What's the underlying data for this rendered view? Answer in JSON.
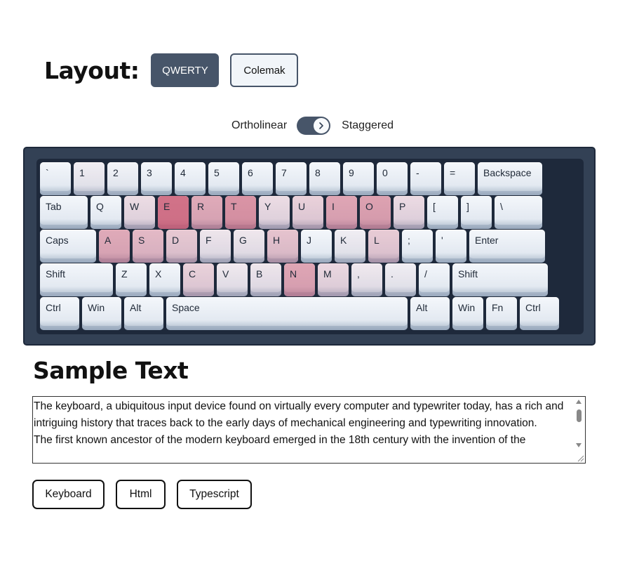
{
  "layout": {
    "title": "Layout:",
    "options": [
      {
        "label": "QWERTY",
        "active": true
      },
      {
        "label": "Colemak",
        "active": false
      }
    ]
  },
  "toggle": {
    "left_label": "Ortholinear",
    "right_label": "Staggered",
    "state": "Staggered"
  },
  "keyboard": {
    "heat_color": "#c84d68",
    "rows": [
      [
        {
          "label": "`",
          "heat": 0
        },
        {
          "label": "1",
          "heat": 0.05
        },
        {
          "label": "2",
          "heat": 0.02
        },
        {
          "label": "3",
          "heat": 0
        },
        {
          "label": "4",
          "heat": 0
        },
        {
          "label": "5",
          "heat": 0
        },
        {
          "label": "6",
          "heat": 0
        },
        {
          "label": "7",
          "heat": 0
        },
        {
          "label": "8",
          "heat": 0
        },
        {
          "label": "9",
          "heat": 0
        },
        {
          "label": "0",
          "heat": 0
        },
        {
          "label": "-",
          "heat": 0
        },
        {
          "label": "=",
          "heat": 0
        },
        {
          "label": "Backspace",
          "heat": 0
        }
      ],
      [
        {
          "label": "Tab",
          "heat": 0
        },
        {
          "label": "Q",
          "heat": 0
        },
        {
          "label": "W",
          "heat": 0.15
        },
        {
          "label": "E",
          "heat": 0.78
        },
        {
          "label": "R",
          "heat": 0.45
        },
        {
          "label": "T",
          "heat": 0.58
        },
        {
          "label": "Y",
          "heat": 0.15
        },
        {
          "label": "U",
          "heat": 0.22
        },
        {
          "label": "I",
          "heat": 0.48
        },
        {
          "label": "O",
          "heat": 0.5
        },
        {
          "label": "P",
          "heat": 0.16
        },
        {
          "label": "[",
          "heat": 0
        },
        {
          "label": "]",
          "heat": 0
        },
        {
          "label": "\\",
          "heat": 0
        }
      ],
      [
        {
          "label": "Caps",
          "heat": 0
        },
        {
          "label": "A",
          "heat": 0.45
        },
        {
          "label": "S",
          "heat": 0.36
        },
        {
          "label": "D",
          "heat": 0.27
        },
        {
          "label": "F",
          "heat": 0.1
        },
        {
          "label": "G",
          "heat": 0.09
        },
        {
          "label": "H",
          "heat": 0.3
        },
        {
          "label": "J",
          "heat": 0
        },
        {
          "label": "K",
          "heat": 0.05
        },
        {
          "label": "L",
          "heat": 0.25
        },
        {
          "label": ";",
          "heat": 0
        },
        {
          "label": "'",
          "heat": 0
        },
        {
          "label": "Enter",
          "heat": 0
        }
      ],
      [
        {
          "label": "Shift",
          "heat": 0
        },
        {
          "label": "Z",
          "heat": 0
        },
        {
          "label": "X",
          "heat": 0
        },
        {
          "label": "C",
          "heat": 0.22
        },
        {
          "label": "V",
          "heat": 0.08
        },
        {
          "label": "B",
          "heat": 0.1
        },
        {
          "label": "N",
          "heat": 0.48
        },
        {
          "label": "M",
          "heat": 0.18
        },
        {
          "label": ",",
          "heat": 0.08
        },
        {
          "label": ".",
          "heat": 0.05
        },
        {
          "label": "/",
          "heat": 0
        },
        {
          "label": "Shift",
          "heat": 0
        }
      ],
      [
        {
          "label": "Ctrl",
          "heat": 0
        },
        {
          "label": "Win",
          "heat": 0
        },
        {
          "label": "Alt",
          "heat": 0
        },
        {
          "label": "Space",
          "heat": 0
        },
        {
          "label": "Alt",
          "heat": 0
        },
        {
          "label": "Win",
          "heat": 0
        },
        {
          "label": "Fn",
          "heat": 0
        },
        {
          "label": "Ctrl",
          "heat": 0
        }
      ]
    ]
  },
  "sample": {
    "title": "Sample Text",
    "paragraphs": [
      "The keyboard, a ubiquitous input device found on virtually every computer and typewriter today, has a rich and intriguing history that traces back to the early days of mechanical engineering and typewriting innovation.",
      "The first known ancestor of the modern keyboard emerged in the 18th century with the invention of the"
    ]
  },
  "tags": [
    "Keyboard",
    "Html",
    "Typescript"
  ]
}
